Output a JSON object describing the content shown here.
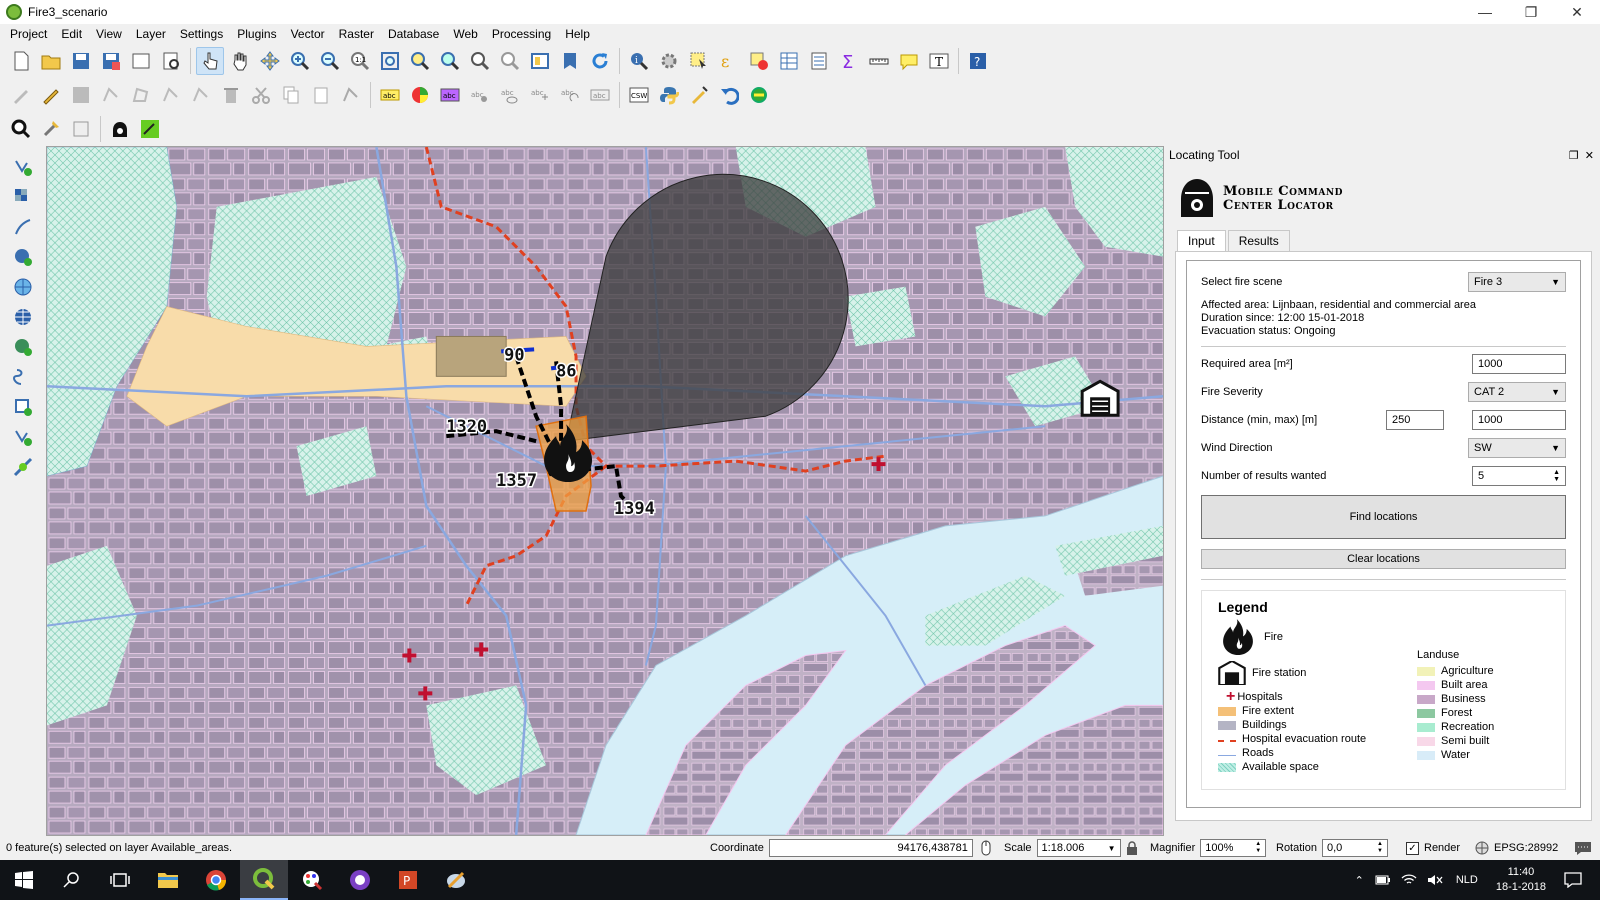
{
  "window": {
    "title": "Fire3_scenario"
  },
  "menu": [
    "Project",
    "Edit",
    "View",
    "Layer",
    "Settings",
    "Plugins",
    "Vector",
    "Raster",
    "Database",
    "Web",
    "Processing",
    "Help"
  ],
  "map": {
    "distance_labels": [
      "90",
      "86",
      "1320",
      "1357",
      "1394"
    ]
  },
  "dock": {
    "title": "Locating Tool",
    "logo_line1": "Mobile Command",
    "logo_line2": "Center Locator",
    "tabs": [
      "Input",
      "Results"
    ],
    "fire_scene_label": "Select fire scene",
    "fire_scene_value": "Fire 3",
    "affected_area": "Affected area: Lijnbaan, residential and commercial area",
    "duration": "Duration since: 12:00 15-01-2018",
    "evacuation": "Evacuation status: Ongoing",
    "required_area_label": "Required area [m²]",
    "required_area_value": "1000",
    "severity_label": "Fire Severity",
    "severity_value": "CAT 2",
    "distance_label": "Distance (min, max) [m]",
    "distance_min": "250",
    "distance_max": "1000",
    "wind_label": "Wind Direction",
    "wind_value": "SW",
    "results_label": "Number of results wanted",
    "results_value": "5",
    "find_button": "Find locations",
    "clear_button": "Clear locations",
    "legend": {
      "title": "Legend",
      "fire": "Fire",
      "fire_station": "Fire station",
      "hospitals": "Hospitals",
      "fire_extent": "Fire extent",
      "buildings": "Buildings",
      "evac_route": "Hospital evacuation route",
      "roads": "Roads",
      "available": "Available space",
      "landuse_title": "Landuse",
      "landuse": [
        "Agriculture",
        "Built area",
        "Business",
        "Forest",
        "Recreation",
        "Semi built",
        "Water"
      ],
      "landuse_colors": [
        "#f2f2b8",
        "#f4c8f0",
        "#c8a8c8",
        "#8cc8a0",
        "#a8ecd0",
        "#f8d8e8",
        "#d8ecf8"
      ]
    }
  },
  "statusbar": {
    "message": "0 feature(s) selected on layer Available_areas.",
    "coordinate_label": "Coordinate",
    "coordinate_value": "94176,438781",
    "scale_label": "Scale",
    "scale_value": "1:18.006",
    "magnifier_label": "Magnifier",
    "magnifier_value": "100%",
    "rotation_label": "Rotation",
    "rotation_value": "0,0",
    "render_label": "Render",
    "crs": "EPSG:28992"
  },
  "taskbar": {
    "lang": "NLD",
    "time": "11:40",
    "date": "18-1-2018"
  }
}
